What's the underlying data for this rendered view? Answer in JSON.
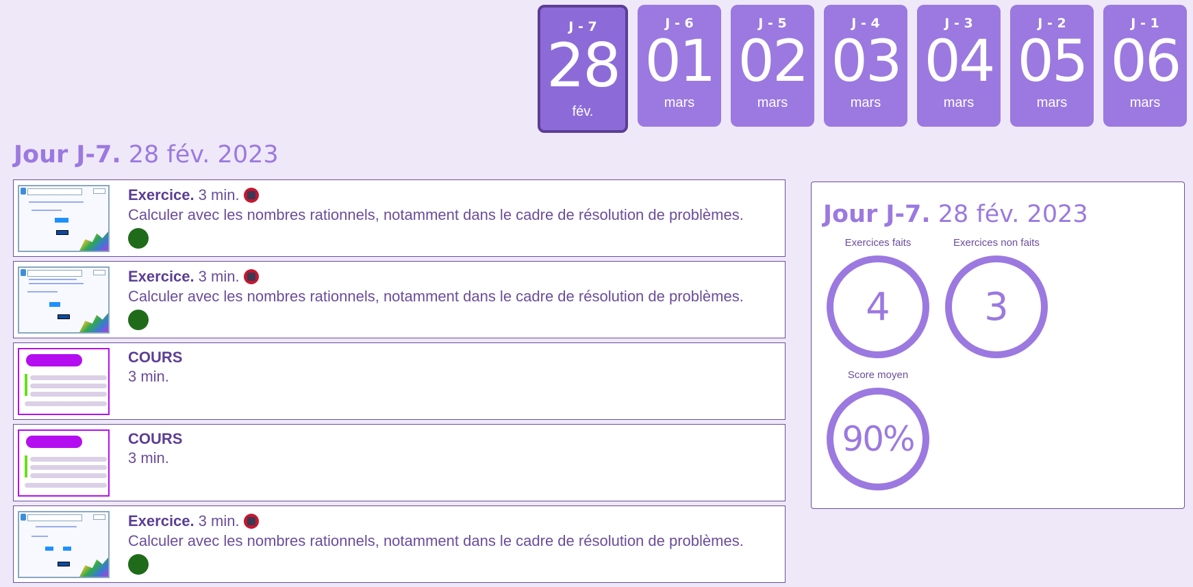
{
  "days": [
    {
      "label": "J - 7",
      "num": "28",
      "month": "fév.",
      "selected": true
    },
    {
      "label": "J - 6",
      "num": "01",
      "month": "mars"
    },
    {
      "label": "J - 5",
      "num": "02",
      "month": "mars"
    },
    {
      "label": "J - 4",
      "num": "03",
      "month": "mars"
    },
    {
      "label": "J - 3",
      "num": "04",
      "month": "mars"
    },
    {
      "label": "J - 2",
      "num": "05",
      "month": "mars"
    },
    {
      "label": "J - 1",
      "num": "06",
      "month": "mars"
    }
  ],
  "heading": {
    "day": "Jour J-7.",
    "date": "28 fév. 2023"
  },
  "activities": [
    {
      "type": "Exercice.",
      "duration": "3 min.",
      "description": "Calculer avec les nombres rationnels, notamment dans le cadre de résolution de problèmes."
    },
    {
      "type": "Exercice.",
      "duration": "3 min.",
      "description": "Calculer avec les nombres rationnels, notamment dans le cadre de résolution de problèmes."
    },
    {
      "type": "COURS",
      "duration": "3 min."
    },
    {
      "type": "COURS",
      "duration": "3 min."
    },
    {
      "type": "Exercice.",
      "duration": "3 min.",
      "description": "Calculer avec les nombres rationnels, notamment dans le cadre de résolution de problèmes."
    }
  ],
  "panel": {
    "title_day": "Jour J-7.",
    "title_date": "28 fév. 2023",
    "done_label": "Exercices faits",
    "done_value": "4",
    "notdone_label": "Exercices non faits",
    "notdone_value": "3",
    "score_label": "Score moyen",
    "score_value": "90%"
  },
  "colors": {
    "background": "#efe8f8",
    "accent": "#9b79e0",
    "text": "#6a4c9c",
    "status_done": "#1f6b1a",
    "badge": "#c8152e"
  },
  "icons": {
    "status": "green-dot-icon",
    "badge": "no-calculator-icon"
  }
}
